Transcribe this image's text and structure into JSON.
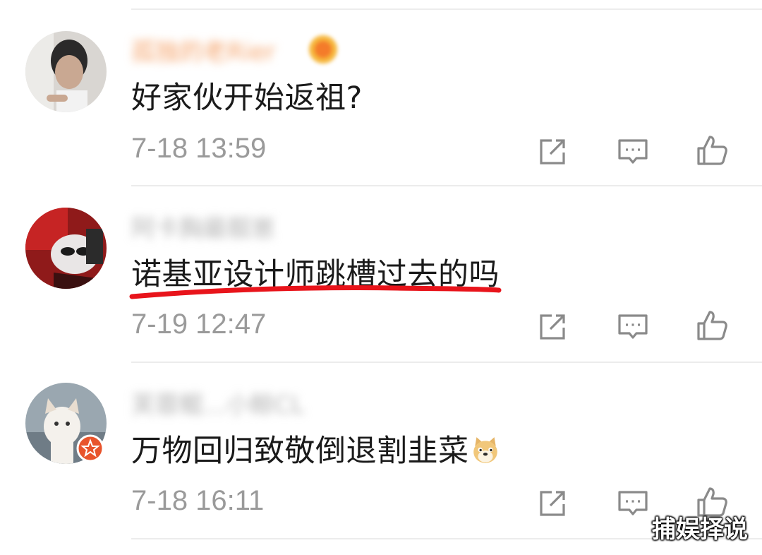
{
  "comments": [
    {
      "username": "孤独的老Rier",
      "text": "好家伙开始返祖?",
      "time": "7-18 13:59"
    },
    {
      "username": "阿卡胸最靓崽",
      "text": "诺基亚设计师跳槽过去的吗",
      "time": "7-19 12:47"
    },
    {
      "username": "芙蓉鲲...小鲸CL",
      "text": "万物回归致敬倒退割韭菜",
      "time": "7-18 16:11"
    }
  ],
  "icons": {
    "share": "share-icon",
    "reply": "comment-icon",
    "like": "like-icon",
    "doge": "doge-emoji-icon"
  },
  "colors": {
    "username_orange": "#f5a46c",
    "username_gray": "#b5b5b5",
    "timestamp": "#9a9a9a",
    "underline_red": "#e8141b",
    "verified_badge": "#e8542c"
  },
  "watermark": "捕娱择说"
}
